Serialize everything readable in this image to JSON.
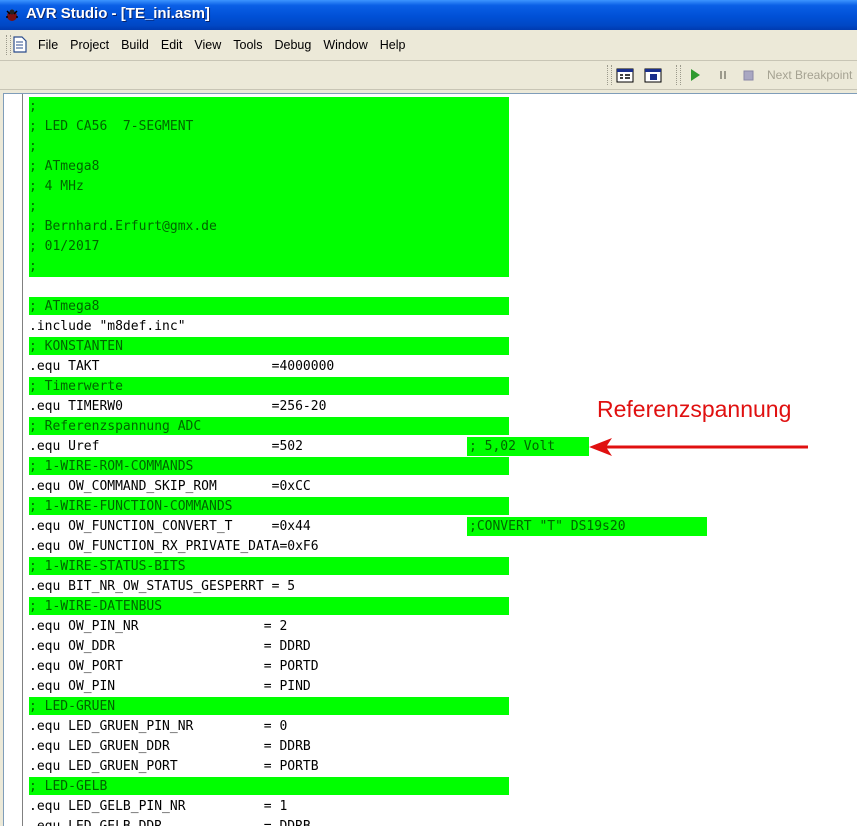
{
  "window": {
    "title": "AVR Studio - [TE_ini.asm]"
  },
  "menu": [
    "File",
    "Project",
    "Build",
    "Edit",
    "View",
    "Tools",
    "Debug",
    "Window",
    "Help"
  ],
  "toolbar": {
    "next_breakpoint_label": "Next Breakpoint",
    "icons": [
      "toolbar-grip",
      "memory-window-icon",
      "processor-window-icon",
      "run-icon",
      "break-icon",
      "stop-icon"
    ]
  },
  "code_lines": [
    ";",
    "; LED CA56  7-SEGMENT",
    ";",
    "; ATmega8",
    "; 4 MHz",
    ";",
    "; Bernhard.Erfurt@gmx.de",
    "; 01/2017",
    ";",
    "",
    "; ATmega8",
    ".include \"m8def.inc\"",
    "; KONSTANTEN",
    ".equ TAKT                      =4000000",
    "; Timerwerte",
    ".equ TIMERW0                   =256-20",
    "; Referenzspannung ADC",
    ".equ Uref                      =502",
    "; 1-WIRE-ROM-COMMANDS",
    ".equ OW_COMMAND_SKIP_ROM       =0xCC",
    "; 1-WIRE-FUNCTION-COMMANDS",
    ".equ OW_FUNCTION_CONVERT_T     =0x44",
    ".equ OW_FUNCTION_RX_PRIVATE_DATA=0xF6",
    "; 1-WIRE-STATUS-BITS",
    ".equ BIT_NR_OW_STATUS_GESPERRT = 5",
    "; 1-WIRE-DATENBUS",
    ".equ OW_PIN_NR                = 2",
    ".equ OW_DDR                   = DDRD",
    ".equ OW_PORT                  = PORTD",
    ".equ OW_PIN                   = PIND",
    "; LED-GRUEN",
    ".equ LED_GRUEN_PIN_NR         = 0",
    ".equ LED_GRUEN_DDR            = DDRB",
    ".equ LED_GRUEN_PORT           = PORTB",
    "; LED-GELB",
    ".equ LED_GELB_PIN_NR          = 1",
    ".equ LED_GELB_DDR             = DDRB"
  ],
  "inline_comments": {
    "uref": "; 5,02 Volt",
    "convert": ";CONVERT \"T\" DS19s20"
  },
  "annotation": {
    "label": "Referenzspannung",
    "color": "#e01010"
  },
  "colors": {
    "highlight": "#00ff00",
    "comment_text": "#006400",
    "titlebar": "#0050d6"
  }
}
